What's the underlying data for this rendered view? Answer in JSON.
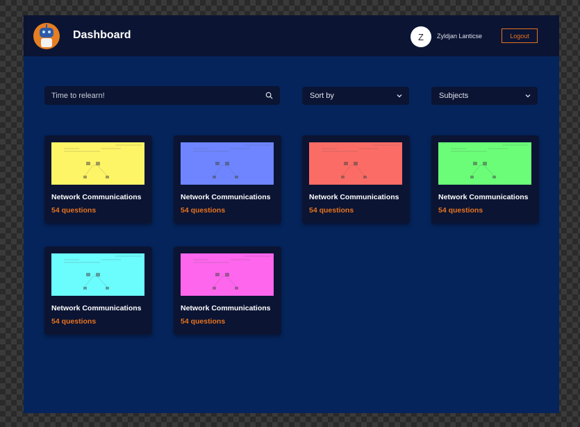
{
  "header": {
    "title": "Dashboard",
    "user_initial": "Z",
    "username": "Zyldjan Lanticse",
    "logout_label": "Logout"
  },
  "filters": {
    "search_placeholder": "Time to relearn!",
    "sort_label": "Sort by",
    "subjects_label": "Subjects"
  },
  "icons": {
    "logo": "robot-logo-icon",
    "search": "search-icon",
    "chevron": "chevron-down-icon"
  },
  "colors": {
    "accent": "#e8731e",
    "background": "#05245b",
    "panel": "#0b1433"
  },
  "cards": [
    {
      "title": "Network Communications",
      "count": "54 questions",
      "thumb_color": "#fdf566"
    },
    {
      "title": "Network Communications",
      "count": "54 questions",
      "thumb_color": "#6e85ff"
    },
    {
      "title": "Network Communications",
      "count": "54 questions",
      "thumb_color": "#fc6c66"
    },
    {
      "title": "Network Communications",
      "count": "54 questions",
      "thumb_color": "#6bfd77"
    },
    {
      "title": "Network Communications",
      "count": "54 questions",
      "thumb_color": "#6bfcfd"
    },
    {
      "title": "Network Communications",
      "count": "54 questions",
      "thumb_color": "#fd66ed"
    }
  ]
}
